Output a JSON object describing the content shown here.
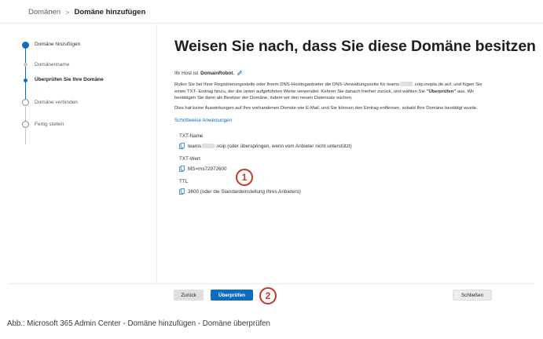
{
  "breadcrumb": {
    "parent": "Domänen",
    "separator": ">",
    "current": "Domäne hinzufügen"
  },
  "steps": [
    {
      "label": "Domäne hinzufügen",
      "state": "done"
    },
    {
      "label": "Domänenname",
      "state": "sub-done"
    },
    {
      "label": "Überprüfen Sie Ihre Domäne",
      "state": "sub-current"
    },
    {
      "label": "Domäne verbinden",
      "state": "todo"
    },
    {
      "label": "Fertig stellen",
      "state": "todo"
    }
  ],
  "main": {
    "title": "Weisen Sie nach, dass Sie diese Domäne besitzen",
    "host_prefix": "Ihr Host ist",
    "host_name": "DomainRobot.",
    "para1_a": "Rufen Sie bei Ihrer Registrierungsstelle oder Ihrem DNS-Hostinganbieter die DNS-Verwaltungsseite für teams",
    "para1_b": ".voip.inopla.de auf,",
    "para1_c": "und fügen Sie einen TXT- Eintrag hinzu, der die unten aufgeführten Werte verwendet. Kehren Sie danach hierher zurück, und wählen Sie",
    "para1_d_bold": "\"Überprüfen\"",
    "para1_d": "aus. Wir bestätigen Sie dann als Besitzer der Domäne, indem wir den neuen Datensatz suchen.",
    "para2": "Dies hat keine Auswirkungen auf Ihre vorhandenen Dienste wie E-Mail, und Sie können den Eintrag entfernen, sobald Ihre Domäne bestätigt wurde.",
    "link": "Schrittweise Anweisungen"
  },
  "records": {
    "txt_name_label": "TXT-Name",
    "txt_name_a": "teams",
    "txt_name_b": ".voip (oder überspringen, wenn vom Anbieter nicht unterstützt)",
    "txt_value_label": "TXT-Wert",
    "txt_value": "MS=ms72972600",
    "ttl_label": "TTL",
    "ttl_value": "3600 (oder die Standardeinstellung Ihres Anbieters)"
  },
  "callouts": {
    "one": "1",
    "two": "2"
  },
  "buttons": {
    "back": "Zurück",
    "verify": "Überprüfen",
    "close": "Schließen"
  },
  "caption": "Abb.: Microsoft 365 Admin Center - Domäne hinzufügen - Domäne überprüfen",
  "colors": {
    "accent": "#0f6cbd",
    "callout": "#c0392b"
  },
  "icons": [
    "pencil-icon",
    "copy-icon"
  ]
}
